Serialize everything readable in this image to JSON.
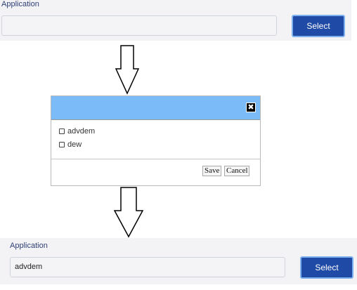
{
  "top_form": {
    "label": "Application",
    "input_value": "",
    "select_label": "Select"
  },
  "dialog": {
    "title": "",
    "close_glyph": "✖",
    "options": [
      {
        "label": "advdem",
        "checked": false
      },
      {
        "label": "dew",
        "checked": false
      }
    ],
    "save_label": "Save",
    "cancel_label": "Cancel"
  },
  "bottom_form": {
    "label": "Application",
    "input_value": "advdem",
    "select_label": "Select"
  },
  "colors": {
    "accent": "#1f4aa5",
    "dialog_header": "#7bbcf8",
    "label": "#2d3e73"
  }
}
